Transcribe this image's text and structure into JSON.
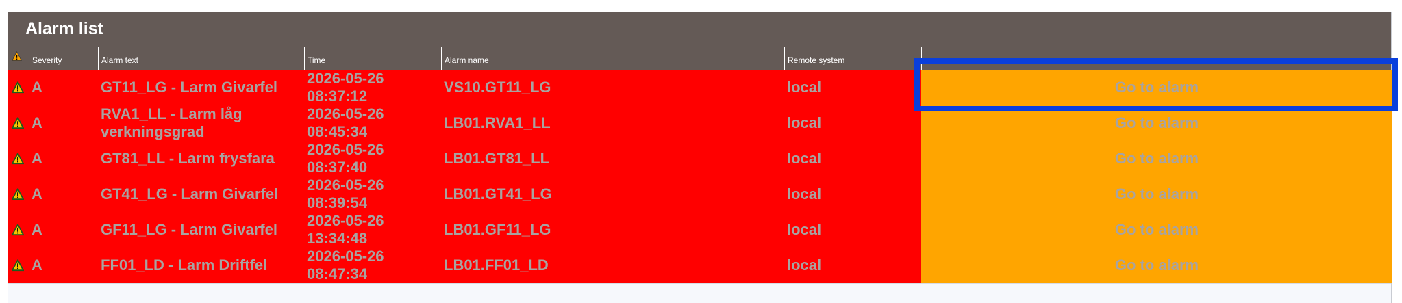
{
  "window": {
    "title": "Alarm list"
  },
  "table": {
    "header_icon": "warning-triangle-icon",
    "columns": [
      "Severity",
      "Alarm text",
      "Time",
      "Alarm name",
      "Remote system",
      ""
    ],
    "rows": [
      {
        "icon": "warning-triangle-icon",
        "severity": "A",
        "text": "GT11_LG - Larm Givarfel",
        "time_date": "2026-05-26",
        "time_clock": "08:37:12",
        "name": "VS10.GT11_LG",
        "remote": "local",
        "action": "Go to alarm"
      },
      {
        "icon": "warning-triangle-icon",
        "severity": "A",
        "text": "RVA1_LL - Larm låg verkningsgrad",
        "time_date": "2026-05-26",
        "time_clock": "08:45:34",
        "name": "LB01.RVA1_LL",
        "remote": "local",
        "action": "Go to alarm"
      },
      {
        "icon": "warning-triangle-icon",
        "severity": "A",
        "text": "GT81_LL - Larm frysfara",
        "time_date": "2026-05-26",
        "time_clock": "08:37:40",
        "name": "LB01.GT81_LL",
        "remote": "local",
        "action": "Go to alarm"
      },
      {
        "icon": "warning-triangle-icon",
        "severity": "A",
        "text": "GT41_LG - Larm Givarfel",
        "time_date": "2026-05-26",
        "time_clock": "08:39:54",
        "name": "LB01.GT41_LG",
        "remote": "local",
        "action": "Go to alarm"
      },
      {
        "icon": "warning-triangle-icon",
        "severity": "A",
        "text": "GF11_LG - Larm Givarfel",
        "time_date": "2026-05-26",
        "time_clock": "13:34:48",
        "name": "LB01.GF11_LG",
        "remote": "local",
        "action": "Go to alarm"
      },
      {
        "icon": "warning-triangle-icon",
        "severity": "A",
        "text": "FF01_LD - Larm Driftfel",
        "time_date": "2026-05-26",
        "time_clock": "08:47:34",
        "name": "LB01.FF01_LD",
        "remote": "local",
        "action": "Go to alarm"
      }
    ]
  },
  "colors": {
    "title_bar": "#645a56",
    "row_alarm": "#ff0000",
    "action_cell": "#ffa500",
    "cell_text": "#a8a3a1",
    "highlight": "#0a3fdc"
  }
}
